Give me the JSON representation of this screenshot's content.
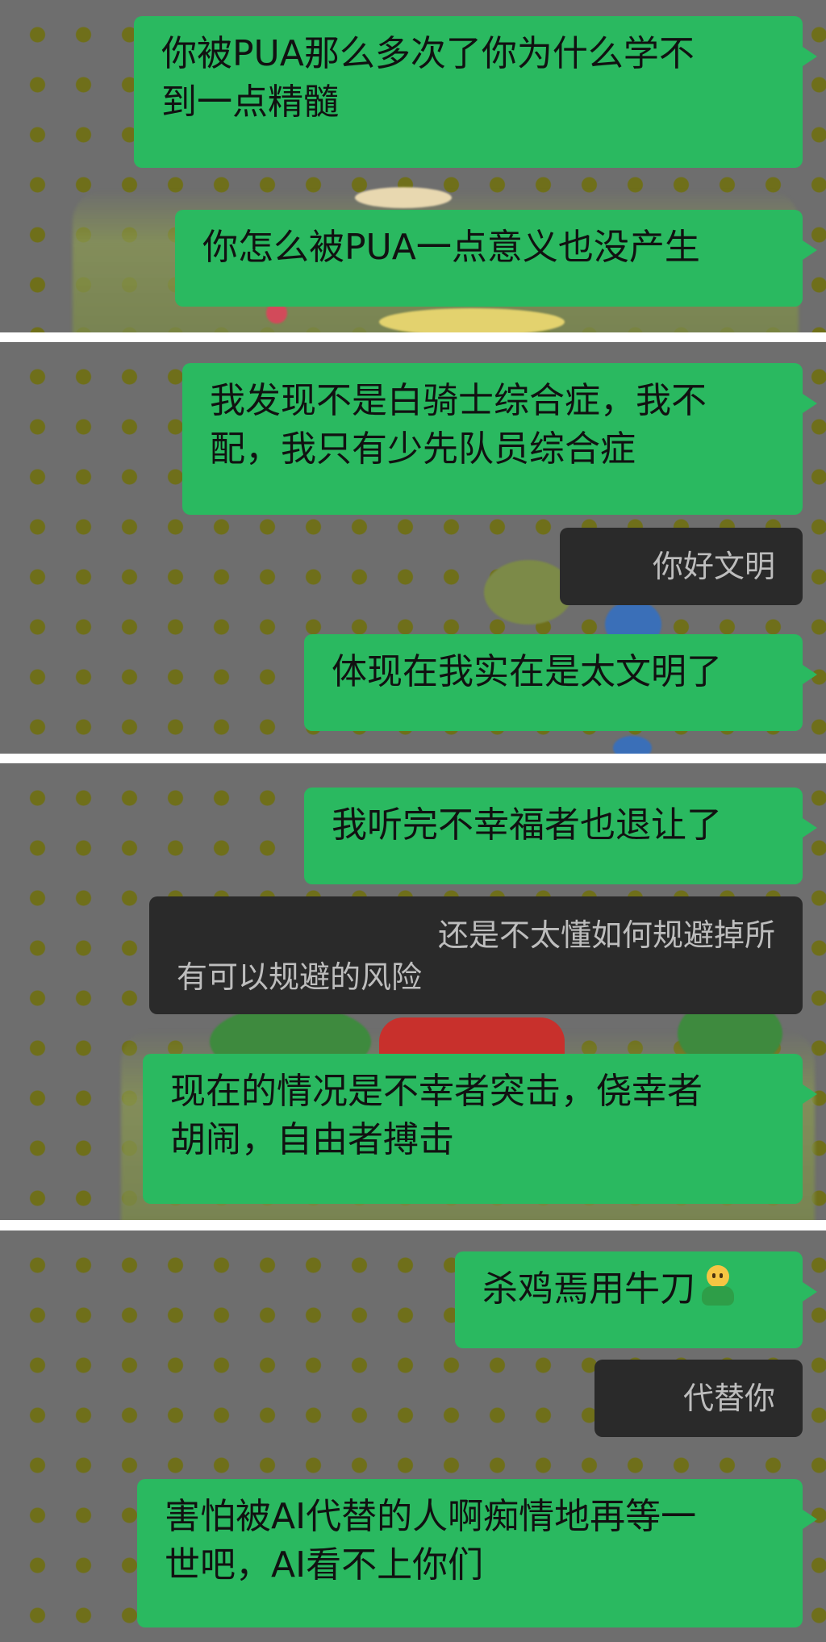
{
  "panels": [
    {
      "messages": [
        {
          "direction": "outgoing",
          "lines": [
            "你被PUA那么多次了你为什么学不",
            "到一点精髓"
          ]
        },
        {
          "direction": "outgoing",
          "lines": [
            "你怎么被PUA一点意义也没产生"
          ]
        }
      ]
    },
    {
      "messages": [
        {
          "direction": "outgoing",
          "lines": [
            "我发现不是白骑士综合症，我不",
            "配，我只有少先队员综合症"
          ]
        },
        {
          "direction": "incoming",
          "lines": [
            "你好文明"
          ]
        },
        {
          "direction": "outgoing",
          "lines": [
            "体现在我实在是太文明了"
          ]
        }
      ]
    },
    {
      "messages": [
        {
          "direction": "outgoing",
          "lines": [
            "我听完不幸福者也退让了"
          ]
        },
        {
          "direction": "incoming",
          "lines": [
            "还是不太懂如何规避掉所",
            "有可以规避的风险"
          ]
        },
        {
          "direction": "outgoing",
          "lines": [
            "现在的情况是不幸者突击，侥幸者",
            "胡闹，自由者搏击"
          ]
        }
      ]
    },
    {
      "messages": [
        {
          "direction": "outgoing",
          "lines": [
            "杀鸡焉用牛刀"
          ],
          "emoji": "person-shrugging-emoji"
        },
        {
          "direction": "incoming",
          "lines": [
            "代替你"
          ]
        },
        {
          "direction": "outgoing",
          "lines": [
            "害怕被AI代替的人啊痴情地再等一",
            "世吧，AI看不上你们"
          ]
        }
      ]
    }
  ],
  "colors": {
    "outgoing_bubble": "#2ab960",
    "incoming_bubble": "#2a2a2a",
    "dot_pattern": "#6f6f1a",
    "background": "#6e6e6e"
  }
}
